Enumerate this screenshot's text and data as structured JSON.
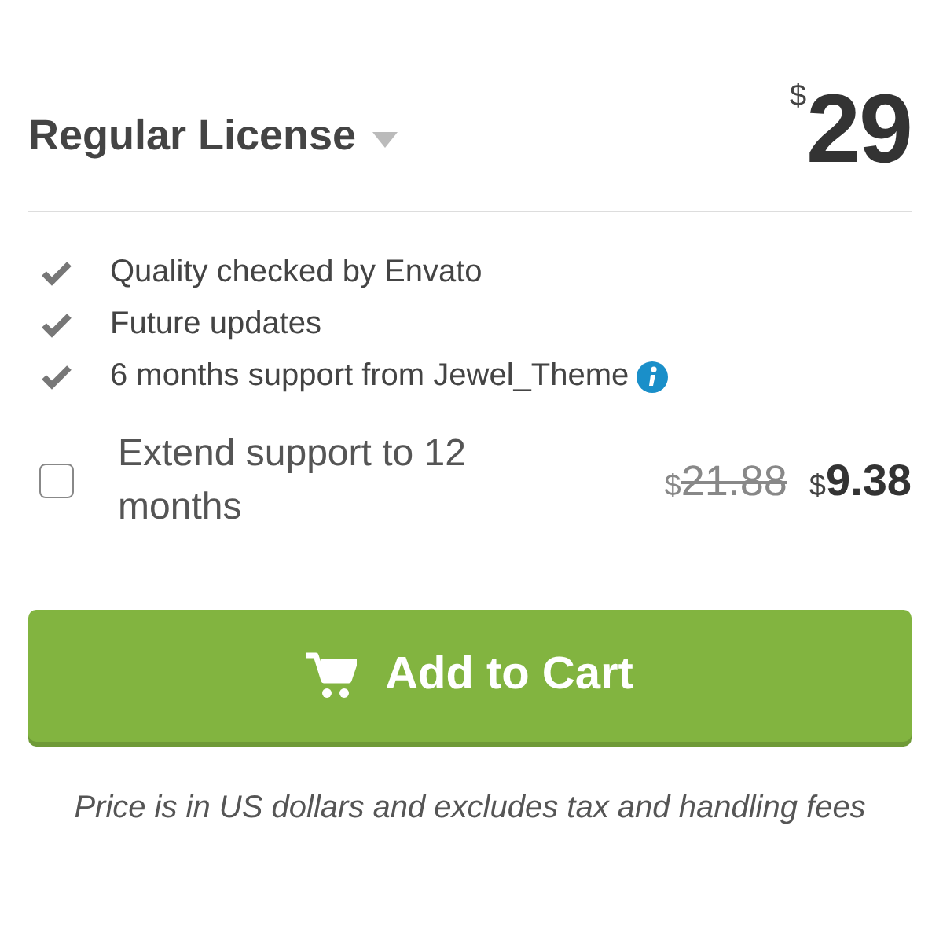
{
  "license": {
    "title": "Regular License",
    "currency": "$",
    "amount": "29"
  },
  "features": [
    {
      "text": "Quality checked by Envato",
      "info": false
    },
    {
      "text": "Future updates",
      "info": false
    },
    {
      "text": "6 months support from Jewel_Theme",
      "info": true
    }
  ],
  "extend": {
    "label": "Extend support to 12 months",
    "checked": false,
    "old_currency": "$",
    "old_amount": "21.88",
    "new_currency": "$",
    "new_amount": "9.38"
  },
  "button": {
    "label": "Add to Cart"
  },
  "note": "Price is in US dollars and excludes tax and handling fees"
}
